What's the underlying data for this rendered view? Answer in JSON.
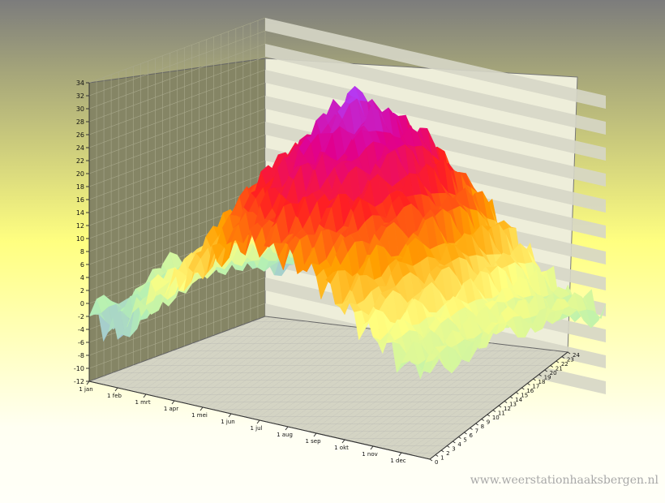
{
  "chart_data": {
    "type": "surface",
    "y_ticks": [
      -12,
      -10,
      -8,
      -6,
      -4,
      -2,
      0,
      2,
      4,
      6,
      8,
      10,
      12,
      14,
      16,
      18,
      20,
      22,
      24,
      26,
      28,
      30,
      32,
      34
    ],
    "x_ticks": [
      "1 jan",
      "1 feb",
      "1 mrt",
      "1 apr",
      "1 mei",
      "1 jun",
      "1 jul",
      "1 aug",
      "1 sep",
      "1 okt",
      "1 nov",
      "1 dec"
    ],
    "z_ticks": [
      0,
      1,
      2,
      3,
      4,
      5,
      6,
      7,
      8,
      9,
      10,
      11,
      12,
      13,
      14,
      15,
      16,
      17,
      18,
      19,
      20,
      21,
      22,
      23,
      24
    ],
    "ylim": [
      -12,
      34
    ],
    "zlim": [
      0,
      24
    ],
    "x_months": [
      0,
      1,
      2,
      3,
      4,
      5,
      6,
      7,
      8,
      9,
      10,
      11
    ],
    "series": [
      {
        "values": [
          -2,
          -4,
          3,
          6,
          9,
          14,
          15,
          14,
          12,
          8,
          5,
          2
        ]
      },
      {
        "values": [
          -1,
          0,
          4,
          11,
          18,
          22,
          26,
          24,
          19,
          13,
          7,
          3
        ]
      },
      {
        "values": [
          1,
          2,
          6,
          14,
          21,
          26,
          33,
          29,
          22,
          15,
          8,
          4
        ]
      },
      {
        "values": [
          0,
          1,
          5,
          12,
          18,
          22,
          27,
          25,
          19,
          12,
          6,
          3
        ]
      },
      {
        "values": [
          -2,
          -3,
          3,
          7,
          10,
          14,
          16,
          15,
          12,
          8,
          4,
          1
        ]
      }
    ],
    "z_levels": [
      0,
      6,
      12,
      18,
      24
    ],
    "colors": [
      "#8888ff",
      "#b4f0b4",
      "#ffff80",
      "#ffa000",
      "#ff2020",
      "#e00090",
      "#b040ff"
    ],
    "grid": true
  },
  "watermark": "www.weerstationhaaksbergen.nl"
}
